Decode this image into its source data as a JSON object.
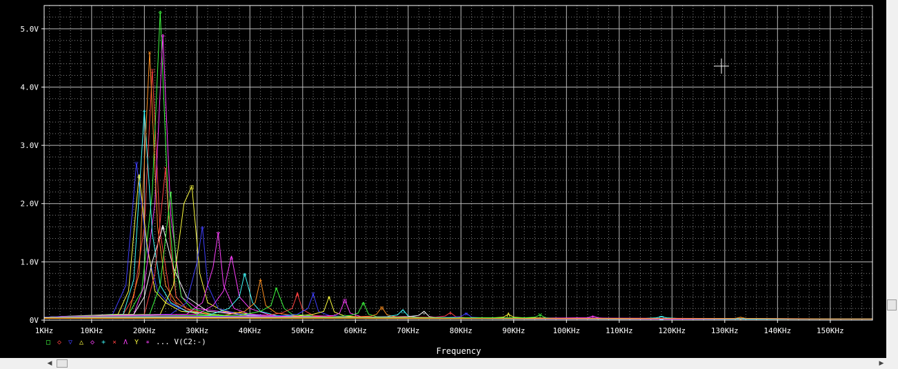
{
  "chart_data": {
    "type": "line",
    "xlabel": "Frequency",
    "ylabel": "",
    "xlim": [
      1,
      158
    ],
    "ylim": [
      0,
      5.4
    ],
    "x_ticks": [
      {
        "value": 1,
        "label": "1KHz"
      },
      {
        "value": 10,
        "label": "10KHz"
      },
      {
        "value": 20,
        "label": "20KHz"
      },
      {
        "value": 30,
        "label": "30KHz"
      },
      {
        "value": 40,
        "label": "40KHz"
      },
      {
        "value": 50,
        "label": "50KHz"
      },
      {
        "value": 60,
        "label": "60KHz"
      },
      {
        "value": 70,
        "label": "70KHz"
      },
      {
        "value": 80,
        "label": "80KHz"
      },
      {
        "value": 90,
        "label": "90KHz"
      },
      {
        "value": 100,
        "label": "100KHz"
      },
      {
        "value": 110,
        "label": "110KHz"
      },
      {
        "value": 120,
        "label": "120KHz"
      },
      {
        "value": 130,
        "label": "130KHz"
      },
      {
        "value": 140,
        "label": "140KHz"
      },
      {
        "value": 150,
        "label": "150KHz"
      }
    ],
    "y_ticks": [
      {
        "value": 0,
        "label": "0V"
      },
      {
        "value": 1,
        "label": "1.0V"
      },
      {
        "value": 2,
        "label": "2.0V"
      },
      {
        "value": 3,
        "label": "3.0V"
      },
      {
        "value": 4,
        "label": "4.0V"
      },
      {
        "value": 5,
        "label": "5.0V"
      }
    ],
    "grid": true,
    "legend": {
      "position": "bottom-left",
      "markers": [
        "□",
        "◇",
        "▽",
        "△",
        "◇",
        "+",
        "×",
        "Λ",
        "Y",
        "∗"
      ],
      "text": "... V(C2:-)"
    },
    "series": [
      {
        "color": "#ff4040",
        "x": [
          1,
          16,
          18,
          20,
          21.5,
          23,
          25,
          27,
          30,
          40,
          60,
          100,
          158
        ],
        "values": [
          0.05,
          0.1,
          0.4,
          1.6,
          4.3,
          1.5,
          0.35,
          0.2,
          0.1,
          0.05,
          0.03,
          0.02,
          0.02
        ]
      },
      {
        "color": "#40ff40",
        "x": [
          1,
          17,
          19.5,
          21.5,
          23,
          24.5,
          26,
          28,
          30,
          40,
          60,
          100,
          158
        ],
        "values": [
          0.05,
          0.1,
          0.5,
          2.2,
          5.3,
          2.0,
          0.4,
          0.2,
          0.1,
          0.05,
          0.03,
          0.02,
          0.02
        ]
      },
      {
        "color": "#4040ff",
        "x": [
          1,
          14,
          16.5,
          18.5,
          20.5,
          22.5,
          24.5,
          28,
          35,
          50,
          100,
          158
        ],
        "values": [
          0.05,
          0.1,
          0.6,
          2.7,
          1.2,
          0.5,
          0.3,
          0.15,
          0.08,
          0.04,
          0.02,
          0.02
        ]
      },
      {
        "color": "#ffff40",
        "x": [
          1,
          15,
          17,
          19,
          20.5,
          22,
          24,
          27,
          35,
          60,
          158
        ],
        "values": [
          0.05,
          0.1,
          0.5,
          2.5,
          1.3,
          0.5,
          0.3,
          0.15,
          0.08,
          0.03,
          0.02
        ]
      },
      {
        "color": "#ff40ff",
        "x": [
          1,
          18,
          20,
          22,
          23.5,
          25,
          27,
          30,
          40,
          60,
          100,
          158
        ],
        "values": [
          0.05,
          0.1,
          0.6,
          2.0,
          4.9,
          1.8,
          0.4,
          0.2,
          0.08,
          0.03,
          0.02,
          0.02
        ]
      },
      {
        "color": "#40ffff",
        "x": [
          1,
          16,
          18,
          20,
          21.5,
          23,
          25,
          28,
          35,
          60,
          158
        ],
        "values": [
          0.05,
          0.1,
          0.7,
          3.6,
          1.5,
          0.6,
          0.3,
          0.15,
          0.08,
          0.03,
          0.02
        ]
      },
      {
        "color": "#ff9020",
        "x": [
          1,
          17,
          19,
          21,
          22.5,
          24,
          26,
          29,
          35,
          60,
          158
        ],
        "values": [
          0.05,
          0.1,
          0.8,
          4.6,
          1.6,
          0.6,
          0.3,
          0.15,
          0.08,
          0.03,
          0.02
        ]
      },
      {
        "color": "#ffffff",
        "x": [
          1,
          18,
          20,
          21.5,
          23.5,
          25.5,
          28,
          32,
          40,
          60,
          158
        ],
        "values": [
          0.05,
          0.1,
          0.4,
          1.0,
          1.6,
          0.9,
          0.4,
          0.15,
          0.08,
          0.03,
          0.02
        ]
      },
      {
        "color": "#ff4040",
        "x": [
          1,
          20,
          22,
          24,
          25,
          26,
          28,
          32,
          40,
          60,
          158
        ],
        "values": [
          0.05,
          0.1,
          0.8,
          2.6,
          1.2,
          0.4,
          0.2,
          0.1,
          0.05,
          0.03,
          0.02
        ]
      },
      {
        "color": "#40ff40",
        "x": [
          1,
          21,
          23,
          25,
          26,
          27,
          29,
          33,
          40,
          60,
          158
        ],
        "values": [
          0.05,
          0.1,
          0.6,
          2.2,
          1.0,
          0.4,
          0.2,
          0.1,
          0.05,
          0.03,
          0.02
        ]
      },
      {
        "color": "#ffff40",
        "x": [
          1,
          23,
          25.5,
          27.5,
          29,
          30.5,
          32,
          35,
          45,
          70,
          158
        ],
        "values": [
          0.05,
          0.1,
          0.6,
          2.0,
          2.3,
          0.8,
          0.3,
          0.15,
          0.06,
          0.03,
          0.02
        ]
      },
      {
        "color": "#4040ff",
        "x": [
          1,
          25,
          28,
          30,
          31,
          32,
          34,
          38,
          50,
          70,
          158
        ],
        "values": [
          0.05,
          0.1,
          0.3,
          1.0,
          1.6,
          0.6,
          0.2,
          0.1,
          0.05,
          0.03,
          0.02
        ]
      },
      {
        "color": "#ff40ff",
        "x": [
          1,
          28,
          31,
          33,
          34,
          35,
          37,
          40,
          50,
          158
        ],
        "values": [
          0.05,
          0.1,
          0.3,
          0.9,
          1.5,
          0.6,
          0.2,
          0.1,
          0.05,
          0.02
        ]
      },
      {
        "color": "#ff40ff",
        "x": [
          1,
          30,
          33,
          35,
          36.5,
          38,
          40,
          44,
          60,
          158
        ],
        "values": [
          0.05,
          0.1,
          0.25,
          0.5,
          1.1,
          0.4,
          0.2,
          0.08,
          0.04,
          0.02
        ]
      },
      {
        "color": "#40ffff",
        "x": [
          1,
          32,
          36,
          38,
          39,
          40.5,
          42,
          45,
          60,
          158
        ],
        "values": [
          0.05,
          0.08,
          0.2,
          0.4,
          0.8,
          0.3,
          0.15,
          0.08,
          0.04,
          0.02
        ]
      },
      {
        "color": "#ff9020",
        "x": [
          1,
          35,
          39,
          41,
          42,
          43,
          45,
          50,
          70,
          158
        ],
        "values": [
          0.05,
          0.08,
          0.15,
          0.3,
          0.7,
          0.25,
          0.12,
          0.06,
          0.03,
          0.02
        ]
      },
      {
        "color": "#40ff40",
        "x": [
          1,
          38,
          42,
          44,
          45,
          46.5,
          48,
          55,
          80,
          158
        ],
        "values": [
          0.05,
          0.08,
          0.15,
          0.25,
          0.55,
          0.2,
          0.1,
          0.05,
          0.03,
          0.02
        ]
      },
      {
        "color": "#ff4040",
        "x": [
          1,
          42,
          46,
          48,
          49,
          50,
          52,
          58,
          80,
          158
        ],
        "values": [
          0.05,
          0.07,
          0.12,
          0.2,
          0.45,
          0.18,
          0.08,
          0.05,
          0.03,
          0.02
        ]
      },
      {
        "color": "#4040ff",
        "x": [
          1,
          45,
          49,
          51,
          52,
          53,
          55,
          60,
          80,
          158
        ],
        "values": [
          0.05,
          0.07,
          0.1,
          0.2,
          0.45,
          0.15,
          0.08,
          0.05,
          0.03,
          0.02
        ]
      },
      {
        "color": "#ffff40",
        "x": [
          1,
          48,
          52,
          54,
          55,
          56,
          58,
          65,
          90,
          158
        ],
        "values": [
          0.04,
          0.06,
          0.1,
          0.15,
          0.4,
          0.14,
          0.07,
          0.04,
          0.03,
          0.02
        ]
      },
      {
        "color": "#ff40ff",
        "x": [
          1,
          52,
          56,
          57,
          58,
          59,
          61,
          68,
          90,
          158
        ],
        "values": [
          0.04,
          0.06,
          0.08,
          0.12,
          0.35,
          0.12,
          0.06,
          0.04,
          0.03,
          0.02
        ]
      },
      {
        "color": "#40ff40",
        "x": [
          1,
          55,
          59,
          60.5,
          61.5,
          62.5,
          64,
          70,
          90,
          158
        ],
        "values": [
          0.04,
          0.05,
          0.08,
          0.12,
          0.3,
          0.1,
          0.06,
          0.04,
          0.03,
          0.02
        ]
      },
      {
        "color": "#ff9020",
        "x": [
          1,
          58,
          63,
          64,
          65,
          66,
          68,
          75,
          100,
          158
        ],
        "values": [
          0.04,
          0.05,
          0.07,
          0.1,
          0.22,
          0.09,
          0.05,
          0.04,
          0.02,
          0.02
        ]
      },
      {
        "color": "#40ffff",
        "x": [
          1,
          62,
          66,
          68,
          69,
          70,
          72,
          80,
          110,
          158
        ],
        "values": [
          0.04,
          0.05,
          0.06,
          0.09,
          0.18,
          0.07,
          0.05,
          0.03,
          0.02,
          0.02
        ]
      },
      {
        "color": "#ffffff",
        "x": [
          1,
          65,
          70,
          72,
          73,
          74,
          76,
          84,
          110,
          158
        ],
        "values": [
          0.04,
          0.05,
          0.06,
          0.08,
          0.15,
          0.06,
          0.04,
          0.03,
          0.02,
          0.02
        ]
      },
      {
        "color": "#ff4040",
        "x": [
          1,
          70,
          75,
          77,
          78,
          79,
          81,
          90,
          120,
          158
        ],
        "values": [
          0.04,
          0.05,
          0.05,
          0.07,
          0.13,
          0.06,
          0.04,
          0.03,
          0.02,
          0.02
        ]
      },
      {
        "color": "#4040ff",
        "x": [
          1,
          72,
          78,
          80,
          81,
          82,
          84,
          92,
          120,
          158
        ],
        "values": [
          0.04,
          0.04,
          0.05,
          0.06,
          0.12,
          0.05,
          0.04,
          0.03,
          0.02,
          0.02
        ]
      },
      {
        "color": "#ffff40",
        "x": [
          1,
          80,
          86,
          88,
          89,
          90,
          92,
          100,
          130,
          158
        ],
        "values": [
          0.04,
          0.04,
          0.04,
          0.05,
          0.1,
          0.05,
          0.04,
          0.03,
          0.02,
          0.02
        ]
      },
      {
        "color": "#40ff40",
        "x": [
          1,
          85,
          92,
          94,
          95,
          96,
          98,
          110,
          158
        ],
        "values": [
          0.03,
          0.04,
          0.04,
          0.05,
          0.09,
          0.04,
          0.03,
          0.03,
          0.02
        ]
      },
      {
        "color": "#ff40ff",
        "x": [
          1,
          95,
          102,
          104,
          105,
          106,
          108,
          120,
          158
        ],
        "values": [
          0.03,
          0.03,
          0.04,
          0.04,
          0.07,
          0.04,
          0.03,
          0.02,
          0.02
        ]
      },
      {
        "color": "#40ffff",
        "x": [
          1,
          105,
          115,
          117,
          118,
          119,
          121,
          135,
          158
        ],
        "values": [
          0.03,
          0.03,
          0.03,
          0.04,
          0.06,
          0.04,
          0.03,
          0.02,
          0.02
        ]
      },
      {
        "color": "#ff9020",
        "x": [
          1,
          115,
          130,
          132,
          133,
          134,
          136,
          150,
          158
        ],
        "values": [
          0.03,
          0.03,
          0.03,
          0.03,
          0.05,
          0.03,
          0.03,
          0.02,
          0.02
        ]
      }
    ]
  },
  "ui": {
    "cursor_marker": "+",
    "scroll_left_arrow": "◀",
    "scroll_right_arrow": "▶"
  }
}
